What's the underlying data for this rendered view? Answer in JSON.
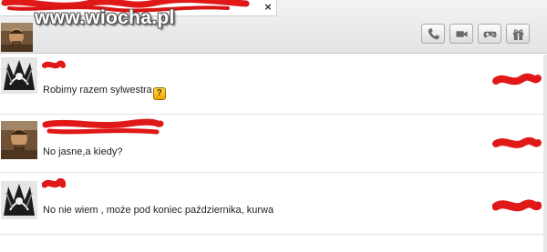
{
  "header": {
    "tab_close": "×",
    "watermark": "www.wiocha.pl",
    "toolbar": [
      {
        "name": "call-button",
        "icon": "phone-icon"
      },
      {
        "name": "video-call-button",
        "icon": "video-camera-icon"
      },
      {
        "name": "games-button",
        "icon": "gamepad-icon"
      },
      {
        "name": "gift-button",
        "icon": "gift-icon"
      }
    ]
  },
  "messages": [
    {
      "sender": "",
      "text": "Robimy razem sylwestra",
      "emoticon": "?",
      "time": ""
    },
    {
      "sender": "",
      "text": "No jasne,a kiedy?",
      "emoticon": "",
      "time": ""
    },
    {
      "sender": "",
      "text": "No nie wiem , może pod koniec października, kurwa",
      "emoticon": "",
      "time": ""
    }
  ],
  "colors": {
    "redaction": "#e01818",
    "header_bg": "#e9e9e9",
    "divider": "#e3e3e3",
    "text": "#222222"
  }
}
